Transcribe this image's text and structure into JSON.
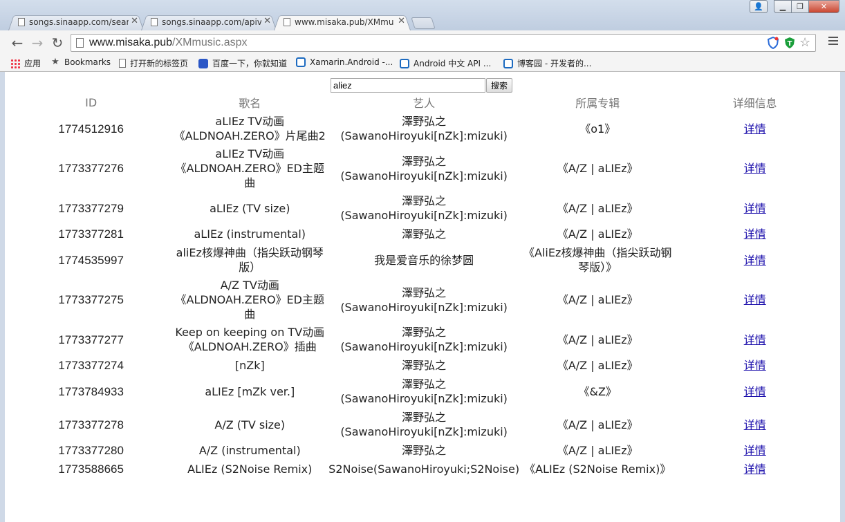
{
  "browser": {
    "tabs": [
      {
        "label": "songs.sinaapp.com/sear",
        "active": false
      },
      {
        "label": "songs.sinaapp.com/apiv",
        "active": false
      },
      {
        "label": "www.misaka.pub/XMmu",
        "active": true
      }
    ],
    "address": {
      "host": "www.misaka.pub",
      "path": "/XMmusic.aspx"
    },
    "bookmarks": [
      {
        "label": "应用",
        "icon": "apps-icon"
      },
      {
        "label": "Bookmarks",
        "icon": "star-icon"
      },
      {
        "label": "打开新的标签页",
        "icon": "page-icon"
      },
      {
        "label": "百度一下，你就知道",
        "icon": "baidu-paw-icon"
      },
      {
        "label": "Xamarin.Android -...",
        "icon": "cnblogs-icon"
      },
      {
        "label": "Android 中文 API ...",
        "icon": "cnblogs-icon"
      },
      {
        "label": "博客园 - 开发者的...",
        "icon": "cnblogs-icon"
      }
    ]
  },
  "search": {
    "value": "aliez",
    "button_label": "搜索"
  },
  "table": {
    "headers": [
      "ID",
      "歌名",
      "艺人",
      "所属专辑",
      "详细信息"
    ],
    "rows": [
      {
        "id": "1774512916",
        "song": "aLIEz TV动画《ALDNOAH.ZERO》片尾曲2",
        "artist": "澤野弘之 (SawanoHiroyuki[nZk]:mizuki)",
        "album": "《o1》",
        "detail": "详情"
      },
      {
        "id": "1773377276",
        "song": "aLIEz TV动画《ALDNOAH.ZERO》ED主题曲",
        "artist": "澤野弘之 (SawanoHiroyuki[nZk]:mizuki)",
        "album": "《A/Z | aLIEz》",
        "detail": "详情"
      },
      {
        "id": "1773377279",
        "song": "aLIEz (TV size)",
        "artist": "澤野弘之 (SawanoHiroyuki[nZk]:mizuki)",
        "album": "《A/Z | aLIEz》",
        "detail": "详情"
      },
      {
        "id": "1773377281",
        "song": "aLIEz (instrumental)",
        "artist": "澤野弘之",
        "album": "《A/Z | aLIEz》",
        "detail": "详情"
      },
      {
        "id": "1774535997",
        "song": "aliEz核爆神曲（指尖跃动钢琴版）",
        "artist": "我是爱音乐的徐梦圆",
        "album": "《AliEz核爆神曲（指尖跃动钢琴版）》",
        "detail": "详情"
      },
      {
        "id": "1773377275",
        "song": "A/Z TV动画《ALDNOAH.ZERO》ED主题曲",
        "artist": "澤野弘之 (SawanoHiroyuki[nZk]:mizuki)",
        "album": "《A/Z | aLIEz》",
        "detail": "详情"
      },
      {
        "id": "1773377277",
        "song": "Keep on keeping on TV动画《ALDNOAH.ZERO》插曲",
        "artist": "澤野弘之 (SawanoHiroyuki[nZk]:mizuki)",
        "album": "《A/Z | aLIEz》",
        "detail": "详情"
      },
      {
        "id": "1773377274",
        "song": "[nZk]",
        "artist": "澤野弘之",
        "album": "《A/Z | aLIEz》",
        "detail": "详情"
      },
      {
        "id": "1773784933",
        "song": "aLIEz [mZk ver.]",
        "artist": "澤野弘之 (SawanoHiroyuki[nZk]:mizuki)",
        "album": "《&Z》",
        "detail": "详情"
      },
      {
        "id": "1773377278",
        "song": "A/Z (TV size)",
        "artist": "澤野弘之 (SawanoHiroyuki[nZk]:mizuki)",
        "album": "《A/Z | aLIEz》",
        "detail": "详情"
      },
      {
        "id": "1773377280",
        "song": "A/Z (instrumental)",
        "artist": "澤野弘之",
        "album": "《A/Z | aLIEz》",
        "detail": "详情"
      },
      {
        "id": "1773588665",
        "song": "ALIEz (S2Noise Remix)",
        "artist": "S2Noise(SawanoHiroyuki;S2Noise)",
        "album": "《ALIEz (S2Noise Remix)》",
        "detail": "详情"
      }
    ]
  }
}
